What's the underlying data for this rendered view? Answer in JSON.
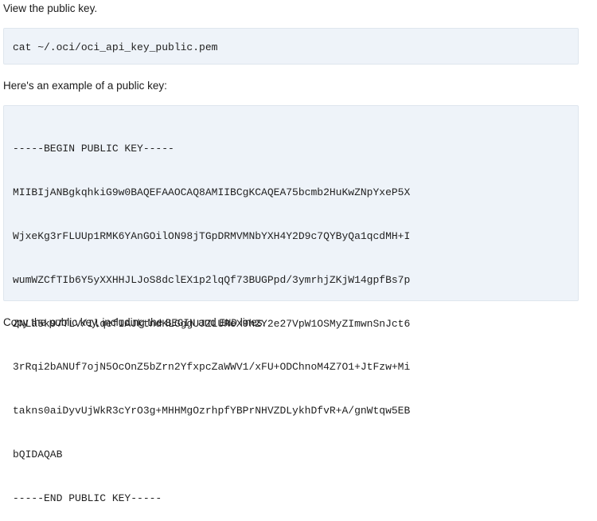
{
  "intro": {
    "text": "View the public key."
  },
  "command_block": {
    "code": "cat ~/.oci/oci_api_key_public.pem"
  },
  "example_intro": {
    "text": "Here's an example of a public key:"
  },
  "key_block": {
    "lines": [
      "-----BEGIN PUBLIC KEY-----",
      "MIIBIjANBgkqhkiG9w0BAQEFAAOCAQ8AMIIBCgKCAQEA75bcmb2HuKwZNpYxeP5X",
      "WjxeKg3rFLUUp1RMK6YAnGOilON98jTGpDRMVMNbYXH4Y2D9c7QYByQa1qcdMH+I",
      "wumWZCfTIb6Y5yXXHHJLJoS8dclEX1p2lqQf73BUGPpd/3ymrhjZKjW14gpfBs7p",
      "ZNLa5k97TLV/IlqefIAJktndKLGggUJZLUReX9hZY2e27VpW1OSMyZImwnSnJct6",
      "3rRqi2bANUf7ojN5OcOnZ5bZrn2YfxpcZaWWV1/xFU+ODChnoM4Z7O1+JtFzw+Mi",
      "takns0aiDyvUjWkR3cYrO3g+MHHMgOzrhpfYBPrNHVZDLykhDfvR+A/gnWtqw5EB",
      "bQIDAQAB",
      "-----END PUBLIC KEY-----"
    ]
  },
  "footer": {
    "text_before": "Copy the public key, including the ",
    "code_begin": "BEGIN",
    "text_middle": " and ",
    "code_end": "END",
    "text_after": " lines."
  }
}
